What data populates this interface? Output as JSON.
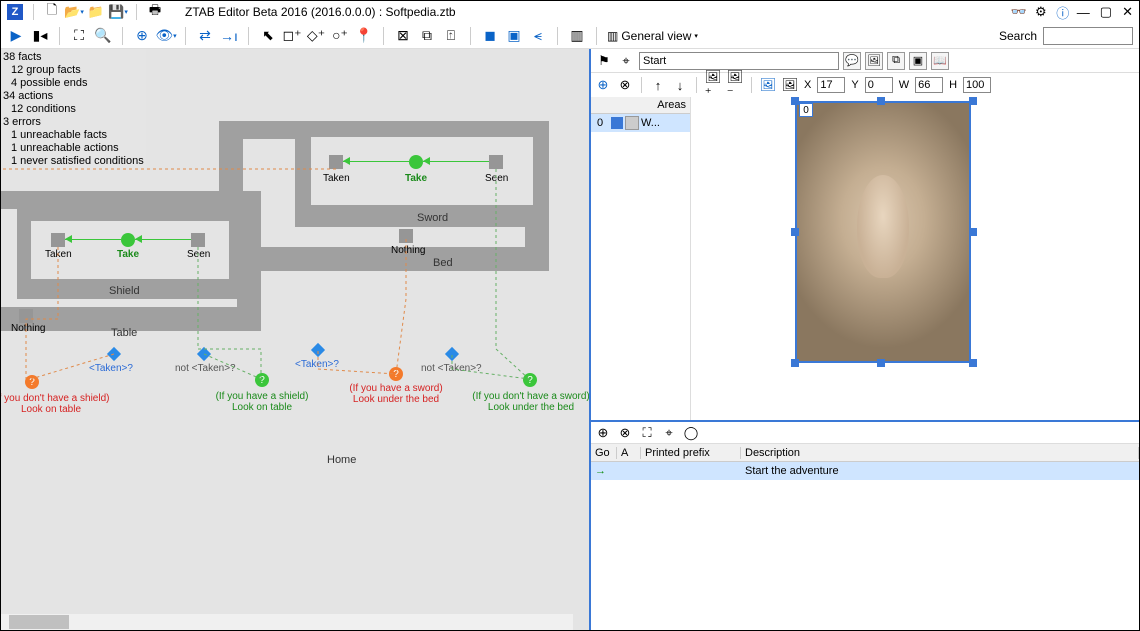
{
  "title": "ZTAB Editor Beta 2016 (2016.0.0.0) : Softpedia.ztb",
  "search_label": "Search",
  "general_view": "General view",
  "stats": [
    "38 facts",
    "12 group facts",
    "4 possible ends",
    "34 actions",
    "12 conditions",
    "3 errors",
    "1 unreachable facts",
    "1 unreachable actions",
    "1 never satisfied conditions"
  ],
  "groups": {
    "sword": "Sword",
    "shield": "Shield",
    "bed": "Bed",
    "table": "Table",
    "home": "Home"
  },
  "nodes": {
    "taken": "Taken",
    "take": "Take",
    "seen": "Seen",
    "nothing": "Nothing",
    "taken_q": "<Taken>?",
    "not_taken_q": "not <Taken>?"
  },
  "conditions": {
    "no_shield": "(If you don't have a shield)\nLook on table",
    "have_shield": "(If you have a shield)\nLook on table",
    "have_sword": "(If you have a sword)\nLook under the bed",
    "no_sword": "(If you don't have a sword)\nLook under the bed"
  },
  "start_input": "Start",
  "coords": {
    "x_label": "X",
    "x": "17",
    "y_label": "Y",
    "y": "0",
    "w_label": "W",
    "w": "66",
    "h_label": "H",
    "h": "100"
  },
  "areas_header": "Areas",
  "arearow": {
    "index": "0",
    "label": "W..."
  },
  "badge_num": "0",
  "table_headers": {
    "go": "Go",
    "a": "A",
    "prefix": "Printed prefix",
    "desc": "Description"
  },
  "table_row": {
    "desc": "Start the adventure"
  }
}
